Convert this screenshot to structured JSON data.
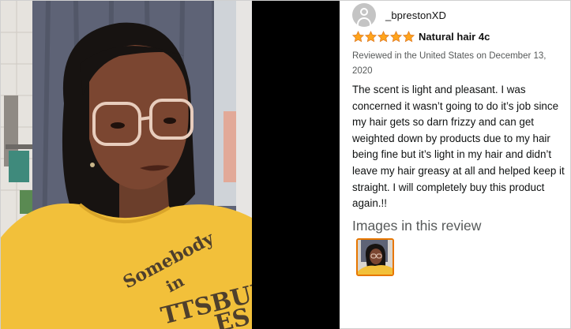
{
  "review": {
    "author": "_bprestonXD",
    "rating": 5,
    "title": "Natural hair 4c",
    "meta": "Reviewed in the United States on December 13, 2020",
    "body": "The scent is light and pleasant. I was concerned it wasn’t going to do it’s job since my hair gets so darn frizzy and can get weighted down by products due to my hair being fine but it’s light in my hair and didn’t leave my hair greasy at all and helped keep it straight. I will completely buy this product again.!!",
    "images_heading": "Images in this review"
  },
  "photo": {
    "shirt_text_line1": "Somebody",
    "shirt_text_line2": "in",
    "shirt_text_line3": "TTSBURG",
    "shirt_text_line4": "ES"
  },
  "colors": {
    "star": "#ffa41c",
    "star_border": "#de7921",
    "thumb_border": "#e77600",
    "shirt": "#f2c03a",
    "text_muted": "#565959"
  },
  "icons": {
    "avatar": "default-user-avatar-icon",
    "star": "star-filled-icon"
  }
}
